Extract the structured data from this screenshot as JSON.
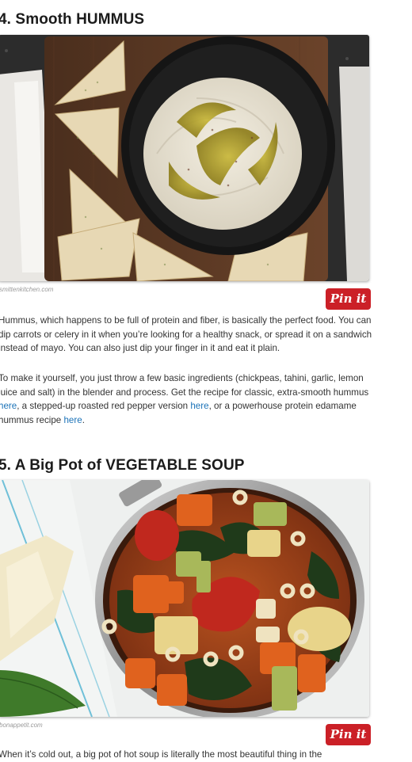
{
  "hummus": {
    "title": "4. Smooth HUMMUS",
    "image_alt": "Bowl of smooth hummus with olive oil and pita chips",
    "credit": "smittenkitchen.com",
    "pin_label": "Pin it",
    "para1": "Hummus, which happens to be full of protein and fiber, is basically the perfect food. You can dip carrots or celery in it when you’re looking for a healthy snack, or spread it on a sandwich instead of mayo. You can also just dip your finger in it and eat it plain.",
    "para2_before": "To make it yourself, you just throw a few basic ingredients (chickpeas, tahini, garlic, lemon juice and salt) in the blender and process. Get the recipe for classic, extra-smooth hummus ",
    "link1": "here",
    "para2_mid": ", a stepped-up roasted red pepper version ",
    "link2": "here",
    "para2_mid2": ", or a powerhouse protein edamame hummus recipe ",
    "link3": "here",
    "para2_end": "."
  },
  "soup": {
    "title": "5. A Big Pot of VEGETABLE SOUP",
    "image_alt": "Pot of vegetable soup with pasta, carrots, kale and tomatoes",
    "credit": "bonappetit.com",
    "pin_label": "Pin it",
    "para1_partial": "When it’s cold out, a big pot of hot soup is literally the most beautiful thing in the"
  },
  "colors": {
    "pin_red": "#cb2027",
    "link_blue": "#1c73b8"
  }
}
